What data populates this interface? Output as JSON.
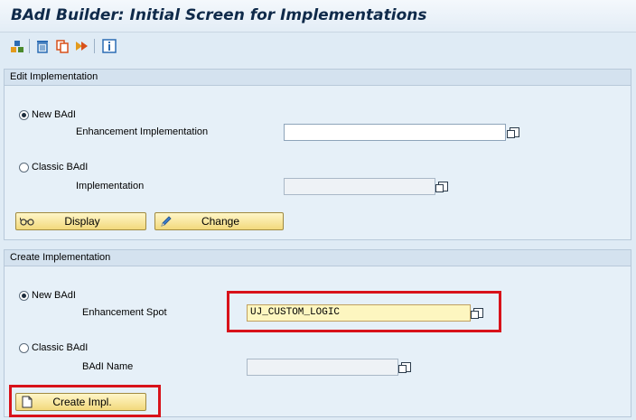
{
  "title": "BAdI Builder: Initial Screen for Implementations",
  "toolbar": {
    "icons": [
      "other-object-icon",
      "delete-icon",
      "copy-icon",
      "rename-icon",
      "info-icon"
    ]
  },
  "edit_group": {
    "header": "Edit Implementation",
    "new_badi_label": "New BAdI",
    "enh_impl_label": "Enhancement Implementation",
    "enh_impl_value": "",
    "classic_badi_label": "Classic BAdI",
    "impl_label": "Implementation",
    "impl_value": "",
    "display_label": "Display",
    "change_label": "Change"
  },
  "create_group": {
    "header": "Create Implementation",
    "new_badi_label": "New BAdI",
    "enh_spot_label": "Enhancement Spot",
    "enh_spot_value": "UJ_CUSTOM_LOGIC",
    "classic_badi_label": "Classic BAdI",
    "badi_name_label": "BAdI Name",
    "badi_name_value": "",
    "create_label": "Create Impl."
  },
  "colors": {
    "highlight": "#d8121a",
    "button": "#f2d97c",
    "background": "#dfebf5"
  }
}
